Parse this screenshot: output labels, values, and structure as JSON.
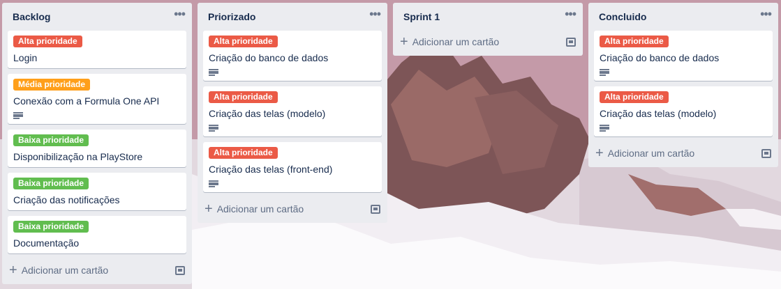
{
  "colors": {
    "alta": "#eb5a46",
    "media": "#ff9f1a",
    "baixa": "#61bd4f"
  },
  "lists": [
    {
      "title": "Backlog",
      "add_label": "Adicionar um cartão",
      "cards": [
        {
          "label": "Alta prioridade",
          "title": "Login",
          "has_description": false
        },
        {
          "label": "Média prioridade",
          "title": "Conexão com a Formula One API",
          "has_description": true
        },
        {
          "label": "Baixa prioridade",
          "title": "Disponibilização na PlayStore",
          "has_description": false
        },
        {
          "label": "Baixa prioridade",
          "title": "Criação das notificações",
          "has_description": false
        },
        {
          "label": "Baixa prioridade",
          "title": "Documentação",
          "has_description": false
        }
      ]
    },
    {
      "title": "Priorizado",
      "add_label": "Adicionar um cartão",
      "cards": [
        {
          "label": "Alta prioridade",
          "title": "Criação do banco de dados",
          "has_description": true
        },
        {
          "label": "Alta prioridade",
          "title": "Criação das telas (modelo)",
          "has_description": true
        },
        {
          "label": "Alta prioridade",
          "title": "Criação das telas (front-end)",
          "has_description": true
        }
      ]
    },
    {
      "title": "Sprint 1",
      "add_label": "Adicionar um cartão",
      "cards": []
    },
    {
      "title": "Concluido",
      "add_label": "Adicionar um cartão",
      "cards": [
        {
          "label": "Alta prioridade",
          "title": "Criação do banco de dados",
          "has_description": true
        },
        {
          "label": "Alta prioridade",
          "title": "Criação das telas (modelo)",
          "has_description": true
        }
      ]
    }
  ]
}
